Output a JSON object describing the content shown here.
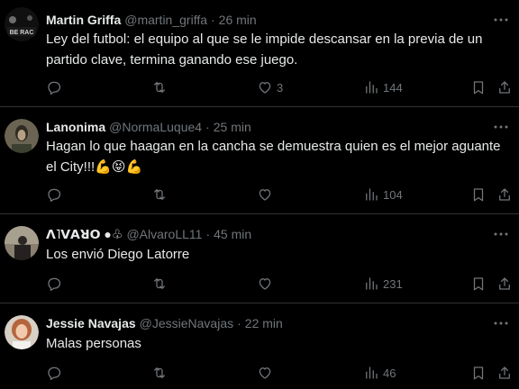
{
  "tweets": [
    {
      "name": "Martin Griffa",
      "handle": "@martin_griffa",
      "sep": "·",
      "time": "26 min",
      "line1": "Ley del futbol: el equipo al que se le impide descansar en la previa de un",
      "line2": "partido clave, termina ganando ese juego.",
      "likes": "3",
      "views": "144",
      "avatar_text": "BE RAC"
    },
    {
      "name": "Lanonima",
      "handle": "@NormaLuque4",
      "sep": "·",
      "time": "25 min",
      "line1": "Hagan lo que haagan en la cancha se demuestra quien es el mejor aguante",
      "line2": "el City!!!",
      "emojis": [
        "💪",
        "😝",
        "💪"
      ],
      "likes": "",
      "views": "104"
    },
    {
      "name": "ꓥ˥ꓦꓮꓤꓳ ●♧",
      "handle": "@AlvaroLL11",
      "sep": "·",
      "time": "45 min",
      "line1": "Los envió Diego Latorre",
      "likes": "",
      "views": "231"
    },
    {
      "name": "Jessie Navajas",
      "handle": "@JessieNavajas",
      "sep": "·",
      "time": "22 min",
      "line1": "Malas personas",
      "likes": "",
      "views": "46"
    }
  ],
  "icons": {
    "more": "more-icon",
    "reply": "reply-icon",
    "retweet": "retweet-icon",
    "like": "heart-icon",
    "views": "views-icon",
    "bookmark": "bookmark-icon",
    "share": "share-icon"
  },
  "colors": {
    "background": "#000000",
    "text": "#e7e9ea",
    "muted": "#71767b",
    "divider": "#2f3336"
  }
}
